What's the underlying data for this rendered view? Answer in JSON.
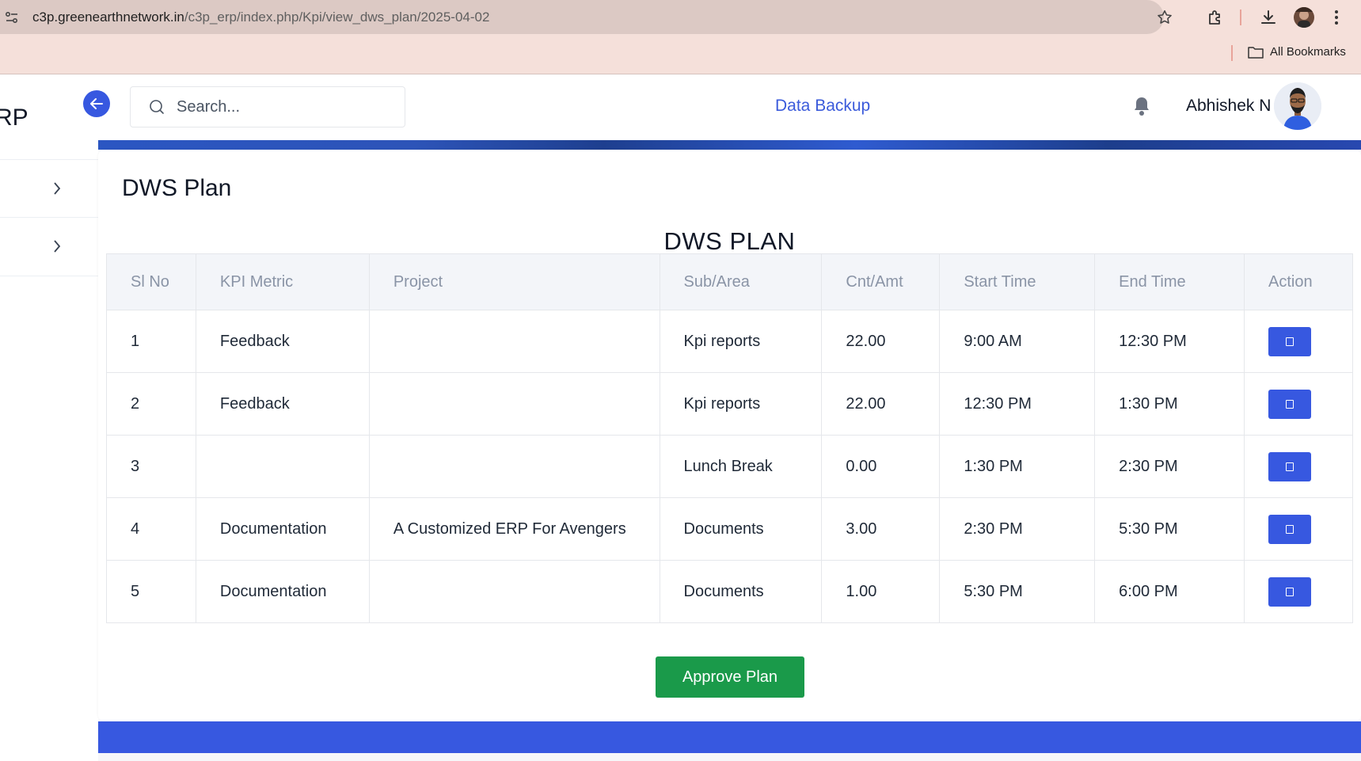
{
  "browser": {
    "url_domain": "c3p.greenearthnetwork.in",
    "url_path": "/c3p_erp/index.php/Kpi/view_dws_plan/2025-04-02",
    "bookmarks_label": "All Bookmarks"
  },
  "sidebar": {
    "brand": "RP"
  },
  "header": {
    "search_placeholder": "Search...",
    "data_backup": "Data Backup",
    "username": "Abhishek N"
  },
  "page": {
    "title": "DWS Plan",
    "table_title": "DWS PLAN",
    "columns": [
      "Sl No",
      "KPI Metric",
      "Project",
      "Sub/Area",
      "Cnt/Amt",
      "Start Time",
      "End Time",
      "Action"
    ],
    "rows": [
      {
        "sl": "1",
        "kpi": "Feedback",
        "project": "",
        "sub": "Kpi reports",
        "cnt": "22.00",
        "start": "9:00 AM",
        "end": "12:30 PM"
      },
      {
        "sl": "2",
        "kpi": "Feedback",
        "project": "",
        "sub": "Kpi reports",
        "cnt": "22.00",
        "start": "12:30 PM",
        "end": "1:30 PM"
      },
      {
        "sl": "3",
        "kpi": "",
        "project": "",
        "sub": "Lunch Break",
        "cnt": "0.00",
        "start": "1:30 PM",
        "end": "2:30 PM"
      },
      {
        "sl": "4",
        "kpi": "Documentation",
        "project": "A Customized ERP For Avengers",
        "sub": "Documents",
        "cnt": "3.00",
        "start": "2:30 PM",
        "end": "5:30 PM"
      },
      {
        "sl": "5",
        "kpi": "Documentation",
        "project": "",
        "sub": "Documents",
        "cnt": "1.00",
        "start": "5:30 PM",
        "end": "6:00 PM"
      }
    ],
    "approve_label": "Approve Plan"
  },
  "colors": {
    "primary": "#3758e0",
    "success": "#1a9a4a",
    "link": "#3b5bdb"
  }
}
